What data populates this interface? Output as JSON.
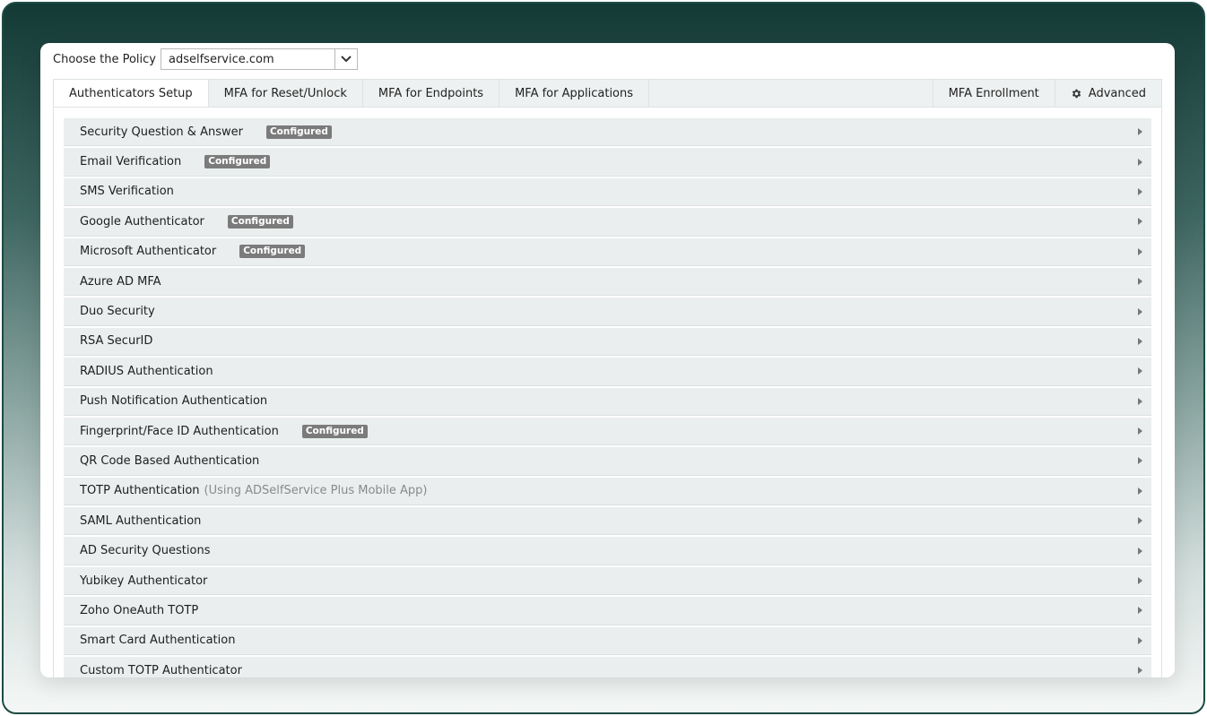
{
  "policy": {
    "label": "Choose the Policy",
    "selected": "adselfservice.com"
  },
  "tabs": {
    "left": [
      "Authenticators Setup",
      "MFA for Reset/Unlock",
      "MFA for Endpoints",
      "MFA for Applications"
    ],
    "active": "Authenticators Setup",
    "enrollment": "MFA Enrollment",
    "advanced": "Advanced"
  },
  "authenticators": [
    {
      "label": "Security Question & Answer",
      "badge": "Configured"
    },
    {
      "label": "Email Verification",
      "badge": "Configured"
    },
    {
      "label": "SMS Verification"
    },
    {
      "label": "Google Authenticator",
      "badge": "Configured"
    },
    {
      "label": "Microsoft Authenticator",
      "badge": "Configured"
    },
    {
      "label": "Azure AD MFA"
    },
    {
      "label": "Duo Security"
    },
    {
      "label": "RSA SecurID"
    },
    {
      "label": "RADIUS Authentication"
    },
    {
      "label": "Push Notification Authentication"
    },
    {
      "label": "Fingerprint/Face ID Authentication",
      "badge": "Configured"
    },
    {
      "label": "QR Code Based Authentication"
    },
    {
      "label": "TOTP Authentication",
      "note": "(Using ADSelfService Plus Mobile App)"
    },
    {
      "label": "SAML Authentication"
    },
    {
      "label": "AD Security Questions"
    },
    {
      "label": "Yubikey Authenticator"
    },
    {
      "label": "Zoho OneAuth TOTP"
    },
    {
      "label": "Smart Card Authentication"
    },
    {
      "label": "Custom TOTP Authenticator"
    }
  ],
  "icons": {
    "dropdown": "chevron-down-icon",
    "advanced": "gear-icon",
    "row": "caret-right-icon"
  },
  "colors": {
    "frame_dark": "#143a36",
    "row_background": "#eaeeee",
    "badge": "#7b7b7b"
  }
}
